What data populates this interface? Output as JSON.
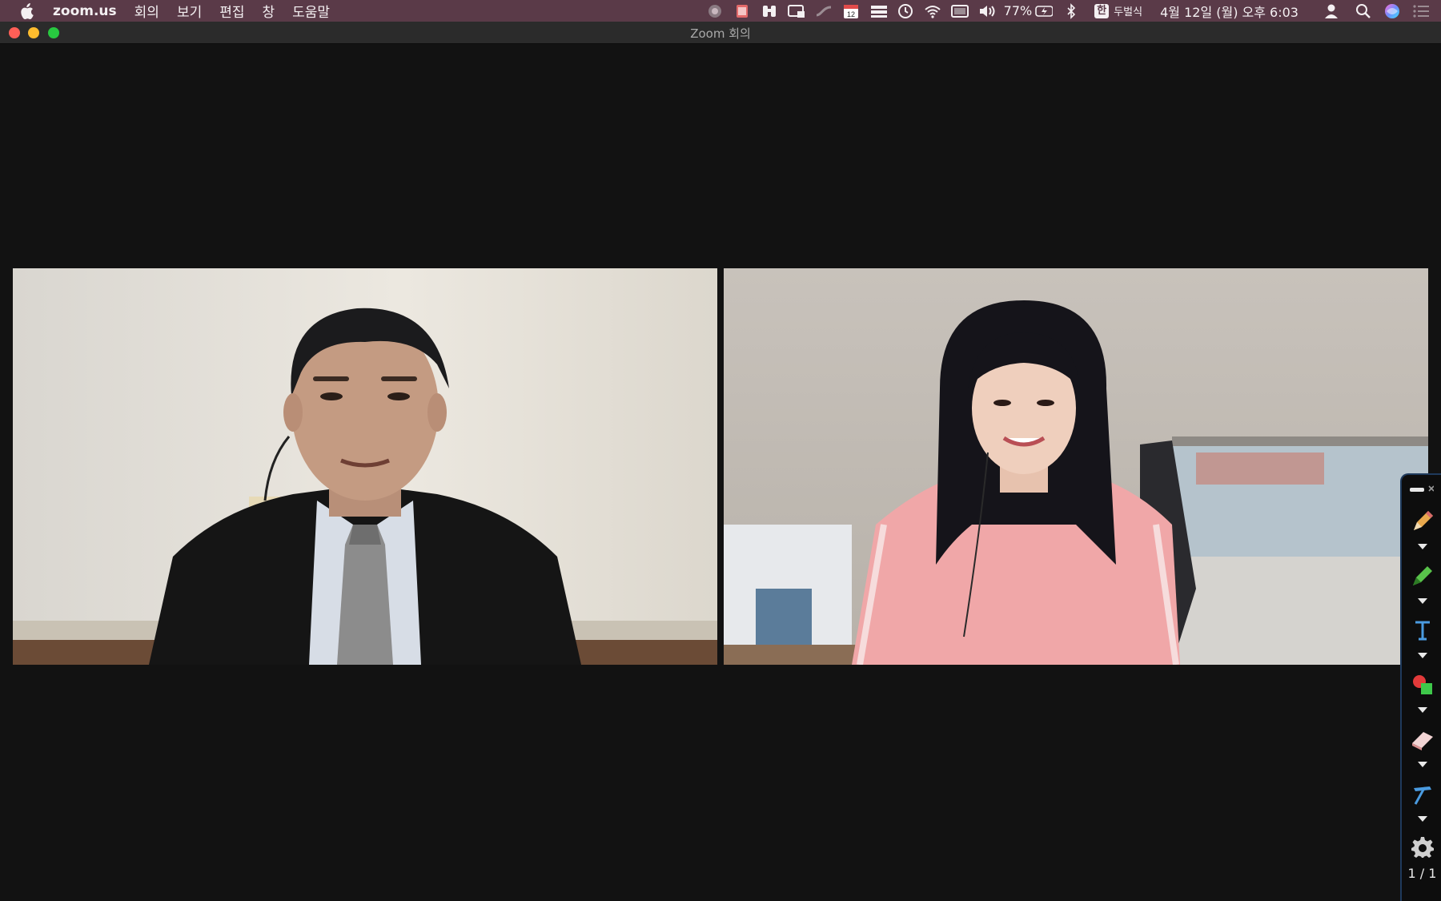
{
  "menubar": {
    "app_name": "zoom.us",
    "menus": [
      "회의",
      "보기",
      "편집",
      "창",
      "도움말"
    ],
    "battery_percent": "77%",
    "input_method": "두벌식",
    "input_badge": "한",
    "calendar_day": "12",
    "clock": "4월 12일 (월) 오후 6:03",
    "status_icons": [
      "screen-record-icon",
      "stack-icon",
      "binoculars-icon",
      "window-icon",
      "swoosh-icon",
      "calendar-icon",
      "layers-icon",
      "time-machine-icon",
      "wifi-icon",
      "display-icon",
      "volume-icon",
      "battery-icon",
      "bluetooth-icon",
      "user-icon",
      "spotlight-icon",
      "siri-icon",
      "notification-center-icon"
    ]
  },
  "window": {
    "title": "Zoom 회의"
  },
  "annotation_toolbar": {
    "tools": [
      "pencil-icon",
      "highlighter-icon",
      "text-tool-icon",
      "shapes-icon",
      "eraser-icon",
      "pointer-icon",
      "gear-icon"
    ],
    "page_indicator": "1 / 1"
  },
  "colors": {
    "menubar_bg": "#5a3a48",
    "window_bg": "#121212",
    "titlebar_bg": "#2b2b2b",
    "toolbar_border": "#1f3a5c"
  }
}
